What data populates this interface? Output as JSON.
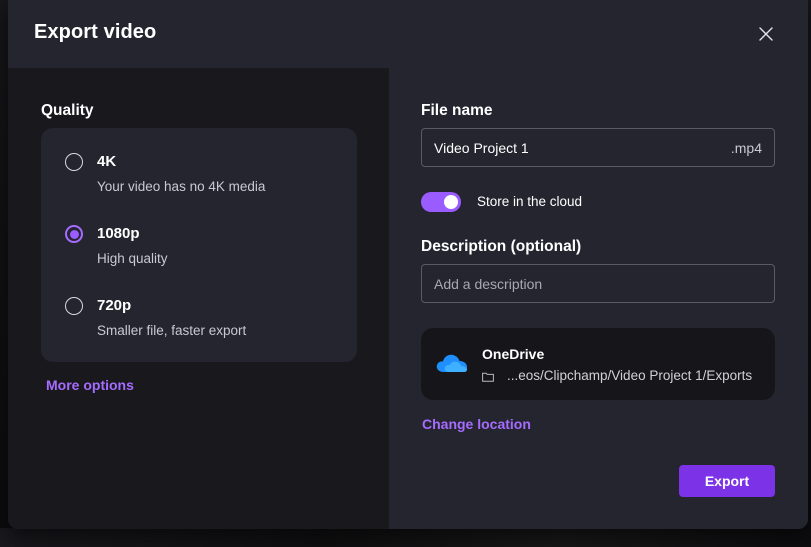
{
  "dialog": {
    "title": "Export video",
    "close_icon": "close-icon"
  },
  "quality": {
    "label": "Quality",
    "options": [
      {
        "title": "4K",
        "subtitle": "Your video has no 4K media",
        "selected": false
      },
      {
        "title": "1080p",
        "subtitle": "High quality",
        "selected": true
      },
      {
        "title": "720p",
        "subtitle": "Smaller file, faster export",
        "selected": false
      }
    ],
    "more_options": "More options"
  },
  "file": {
    "label": "File name",
    "value": "Video Project 1",
    "extension": ".mp4"
  },
  "cloud": {
    "label": "Store in the cloud",
    "enabled": true
  },
  "description": {
    "label": "Description (optional)",
    "placeholder": "Add a description"
  },
  "location": {
    "service": "OneDrive",
    "path": "...eos/Clipchamp/Video Project 1/Exports",
    "change_label": "Change location"
  },
  "actions": {
    "export_label": "Export"
  },
  "colors": {
    "accent": "#9b5cff",
    "link": "#a56cff",
    "button": "#7c33e8"
  }
}
